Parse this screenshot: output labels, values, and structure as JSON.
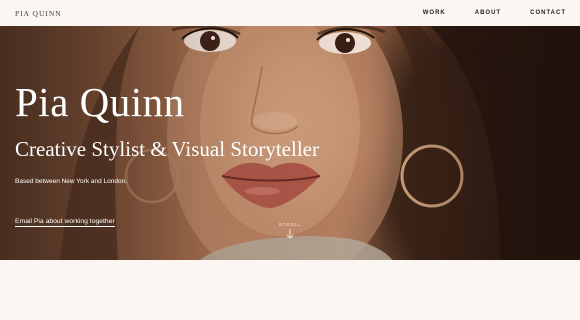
{
  "header": {
    "brand": "PIA QUINN",
    "nav": [
      {
        "label": "WORK"
      },
      {
        "label": "ABOUT"
      },
      {
        "label": "CONTACT"
      }
    ]
  },
  "hero": {
    "title": "Pia Quinn",
    "subtitle": "Creative Stylist & Visual Storyteller",
    "location": "Based between New York and London.",
    "cta": "Email Pia about working together",
    "scroll_label": "SCROLL"
  },
  "icons": {
    "scroll": "arrow-down-icon"
  },
  "colors": {
    "background": "#fbf6f1",
    "hero_text": "#ffffff",
    "nav_text": "#222222"
  }
}
